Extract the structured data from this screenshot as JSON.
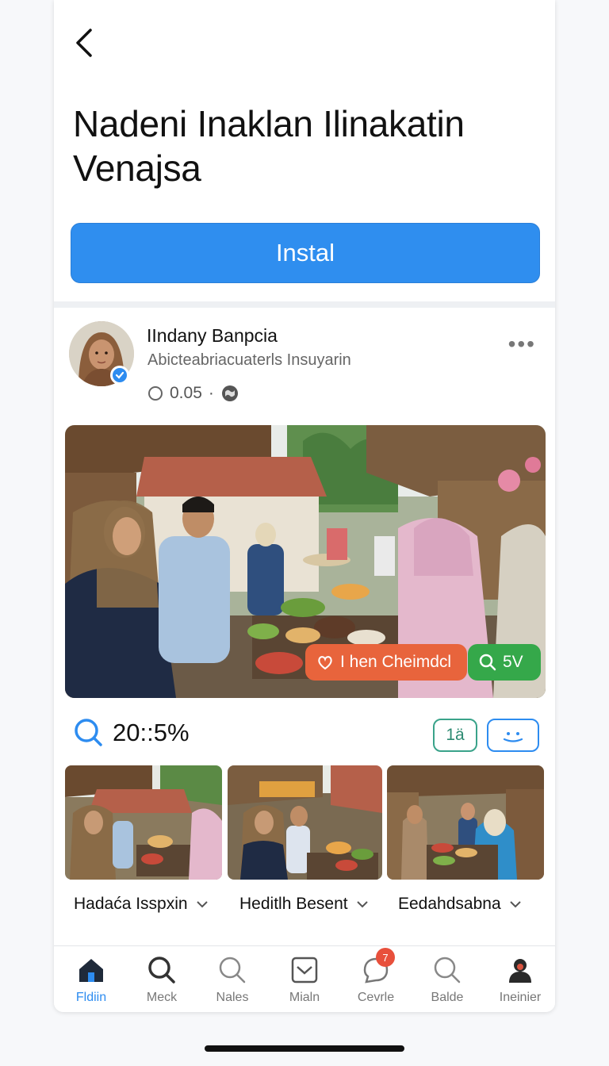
{
  "header": {
    "back_icon": "chevron-left-icon",
    "title": "Nadeni Inaklan Ilinakatin Venajsa",
    "install_label": "Instal"
  },
  "post": {
    "author_name": "IIndany Banpcia",
    "author_subtitle": "Abicteabriacuaterls Insuyarin",
    "meta_time": "0.05",
    "meta_separator": "·",
    "verified_icon": "verified-check-icon",
    "more_icon": "more-horizontal-icon",
    "more_label": "•••",
    "photo_tags": {
      "orange_label": "I hen Cheimdcl",
      "orange_icon": "heart-icon",
      "orange_color": "#e8643c",
      "green_label": "5V",
      "green_icon": "search-icon",
      "green_color": "#35a84a"
    }
  },
  "stats": {
    "value": "20::5%",
    "badge_label": "1ä",
    "chat_icon": "chat-icon"
  },
  "thumbnails": [
    {
      "label": "Hadaća Isspxin"
    },
    {
      "label": "Heditlh Besent"
    },
    {
      "label": "Eedahdsabna"
    }
  ],
  "bottom_nav": [
    {
      "label": "Fldiin",
      "icon": "home-icon",
      "active": true
    },
    {
      "label": "Meck",
      "icon": "search-icon",
      "active": false
    },
    {
      "label": "Nales",
      "icon": "search-icon",
      "active": false
    },
    {
      "label": "Mialn",
      "icon": "mail-icon",
      "active": false
    },
    {
      "label": "Cevrle",
      "icon": "chat-bubble-icon",
      "active": false,
      "badge": "7"
    },
    {
      "label": "Balde",
      "icon": "search-icon",
      "active": false
    },
    {
      "label": "Ineinier",
      "icon": "profile-icon",
      "active": false
    }
  ],
  "colors": {
    "accent": "#2f8eef",
    "badge_green": "#3aa38a",
    "notification": "#e8503c"
  }
}
